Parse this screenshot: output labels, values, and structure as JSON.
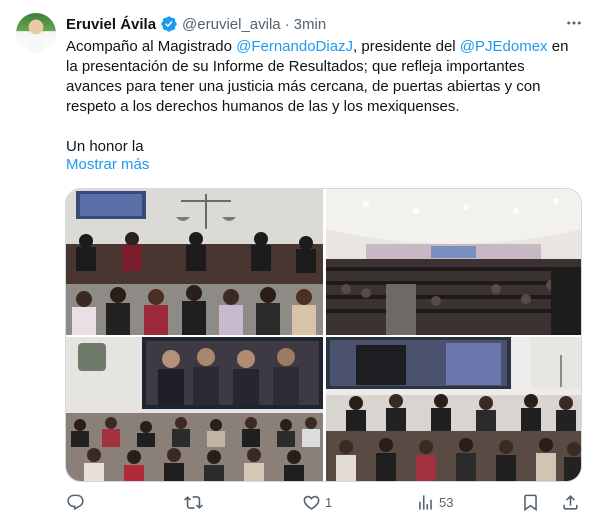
{
  "author": {
    "name": "Eruviel Ávila",
    "handle": "@eruviel_avila",
    "separator": "·",
    "time": "3min"
  },
  "tweet": {
    "line1_prefix": "Acompaño al Magistrado ",
    "mention1": "@FernandoDiazJ",
    "line1_mid": ", presidente del ",
    "mention2": "@PJEdomex",
    "line1_suffix": " en la presentación de su Informe de Resultados; que refleja importantes avances para tener una justicia más cercana, de puertas abiertas y con respeto a los derechos humanos de las y los mexiquenses.",
    "second_paragraph": "Un honor la",
    "show_more": "Mostrar más"
  },
  "actions": {
    "reply_count": "",
    "retweet_count": "",
    "like_count": "1",
    "views_count": "53"
  },
  "colors": {
    "accent": "#1d9bf0",
    "muted": "#536471",
    "text": "#0f1419",
    "border": "#cfd9de"
  },
  "icons": [
    "verified-badge-icon",
    "more-icon",
    "reply-icon",
    "retweet-icon",
    "like-icon",
    "views-icon",
    "bookmark-icon",
    "share-icon"
  ]
}
